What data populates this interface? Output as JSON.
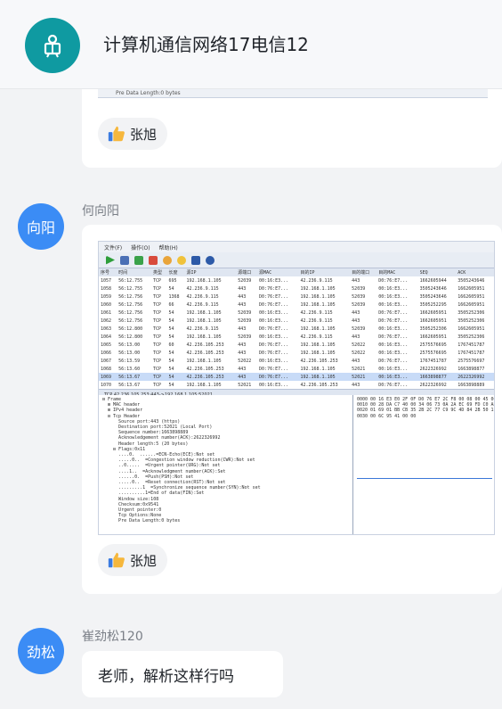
{
  "header": {
    "title": "计算机通信网络17电信12",
    "group_avatar_glyph": "㐅"
  },
  "messages": [
    {
      "like": {
        "liker": "张旭"
      },
      "shot_caption": "Pre Data Length:0 bytes"
    },
    {
      "sender": "何向阳",
      "avatar_text": "向阳",
      "avatar_color": "#3b8cf5",
      "screenshot": {
        "menu": [
          "文件(F)",
          "操作(O)",
          "帮助(H)"
        ],
        "columns": [
          "序号",
          "时间",
          "类型",
          "长度",
          "源IP",
          "源端口",
          "源MAC",
          "目的IP",
          "目的端口",
          "目的MAC",
          "SEQ",
          "ACK"
        ],
        "rows": [
          [
            "1057",
            "56:12.755",
            "TCP",
            "695",
            "192.168.1.105",
            "52039",
            "00:16:E3...",
            "42.236.9.115",
            "443",
            "D0:76:E7...",
            "1662605944",
            "3505243646"
          ],
          [
            "1058",
            "56:12.755",
            "TCP",
            "54",
            "42.236.9.115",
            "443",
            "D0:76:E7...",
            "192.168.1.105",
            "52039",
            "00:16:E3...",
            "3505243646",
            "1662605951"
          ],
          [
            "1059",
            "56:12.756",
            "TCP",
            "1368",
            "42.236.9.115",
            "443",
            "D0:76:E7...",
            "192.168.1.105",
            "52039",
            "00:16:E3...",
            "3505243646",
            "1662605951"
          ],
          [
            "1060",
            "56:12.756",
            "TCP",
            "66",
            "42.236.9.115",
            "443",
            "D0:76:E7...",
            "192.168.1.105",
            "52039",
            "00:16:E3...",
            "3505252295",
            "1662605951"
          ],
          [
            "1061",
            "56:12.756",
            "TCP",
            "54",
            "192.168.1.105",
            "52039",
            "00:16:E3...",
            "42.236.9.115",
            "443",
            "D0:76:E7...",
            "1662605951",
            "3505252306"
          ],
          [
            "1062",
            "56:12.756",
            "TCP",
            "54",
            "192.168.1.105",
            "52039",
            "00:16:E3...",
            "42.236.9.115",
            "443",
            "D0:76:E7...",
            "1662605951",
            "3505252306"
          ],
          [
            "1063",
            "56:12.800",
            "TCP",
            "54",
            "42.236.9.115",
            "443",
            "D0:76:E7...",
            "192.168.1.105",
            "52039",
            "00:16:E3...",
            "3505252306",
            "1662605951"
          ],
          [
            "1064",
            "56:12.800",
            "TCP",
            "54",
            "192.168.1.105",
            "52039",
            "00:16:E3...",
            "42.236.9.115",
            "443",
            "D0:76:E7...",
            "1662605951",
            "3505252306"
          ],
          [
            "1065",
            "56:13.00",
            "TCP",
            "60",
            "42.236.105.253",
            "443",
            "D0:76:E7...",
            "192.168.1.105",
            "52022",
            "00:16:E3...",
            "2575576695",
            "1767451787"
          ],
          [
            "1066",
            "56:13.00",
            "TCP",
            "54",
            "42.236.105.253",
            "443",
            "D0:76:E7...",
            "192.168.1.105",
            "52022",
            "00:16:E3...",
            "2575576695",
            "1767451787"
          ],
          [
            "1067",
            "56:13.59",
            "TCP",
            "54",
            "192.168.1.105",
            "52022",
            "00:16:E3...",
            "42.236.105.253",
            "443",
            "D0:76:E7...",
            "1767451787",
            "2575576697"
          ],
          [
            "1068",
            "56:13.60",
            "TCP",
            "54",
            "42.236.105.253",
            "443",
            "D0:76:E7...",
            "192.168.1.105",
            "52021",
            "00:16:E3...",
            "2622326992",
            "1663898877"
          ],
          [
            "1069",
            "56:13.67",
            "TCP",
            "54",
            "42.236.105.253",
            "443",
            "D0:76:E7...",
            "192.168.1.105",
            "52021",
            "00:16:E3...",
            "1663898877",
            "2622326992"
          ],
          [
            "1070",
            "56:13.67",
            "TCP",
            "54",
            "192.168.1.105",
            "52021",
            "00:16:E3...",
            "42.236.105.253",
            "443",
            "D0:76:E7...",
            "2622326992",
            "1663898889"
          ]
        ],
        "selected_index": 12,
        "filter": "TCP 42.236.105.253:443->192.168.1.105:52021",
        "tree": [
          "⊟ Frame",
          "  ⊞ MAC header",
          "  ⊞ IPv4 header",
          "  ⊟ Tcp Header",
          "      Source port:443 (https)",
          "      Destination port:52021 (Local Port)",
          "      Sequence number:1663898889",
          "      Acknowledgement number(ACK):2622326992",
          "      Header length:5 (20 bytes)",
          "    ⊟ Flags:0x11",
          "      ....0.  ......=ECN-Echo(ECE):Not set",
          "      .....0..  =Congestion window reduction(CWR):Not set",
          "      ..0.....  =Urgent pointer(URG):Not set",
          "      ....1..  =Acknowledgment number(ACK):Set",
          "      ......0.  =Push(PSH):Not set",
          "      .....0..  =Reset connection(RST):Not set",
          "      .........1  =Synchronize sequence number(SYN):Not set",
          "      ..........1=End of data(FIN):Set",
          "      Window size:108",
          "      Checksum:0x9541",
          "      Urgent pointer:0",
          "      Tcp Options:None",
          "      Pre Data Length:0 bytes"
        ],
        "hex": [
          "0000 00 16 E3 E0 2F 0F D0 76 E7 2C F8 00 08 00 45 00",
          "0010 00 28 DA C7 40 00 34 06 73 0A 2A EC 69 FD C0 A8",
          "0020 01 69 01 BB CB 35 2B 2C 77 C9 9C 4D 84 2B 50 11",
          "0030 00 6C 95 41 00 00"
        ]
      },
      "like": {
        "liker": "张旭"
      }
    },
    {
      "sender": "崔劲松120",
      "avatar_text": "劲松",
      "avatar_color": "#3b8cf5",
      "text": "老师，解析这样行吗"
    }
  ],
  "icons": {
    "group": "book-reader-icon",
    "like": "thumbs-up-icon"
  },
  "colors": {
    "accent_teal": "#0f9aa1",
    "avatar_blue": "#3b8cf5"
  }
}
